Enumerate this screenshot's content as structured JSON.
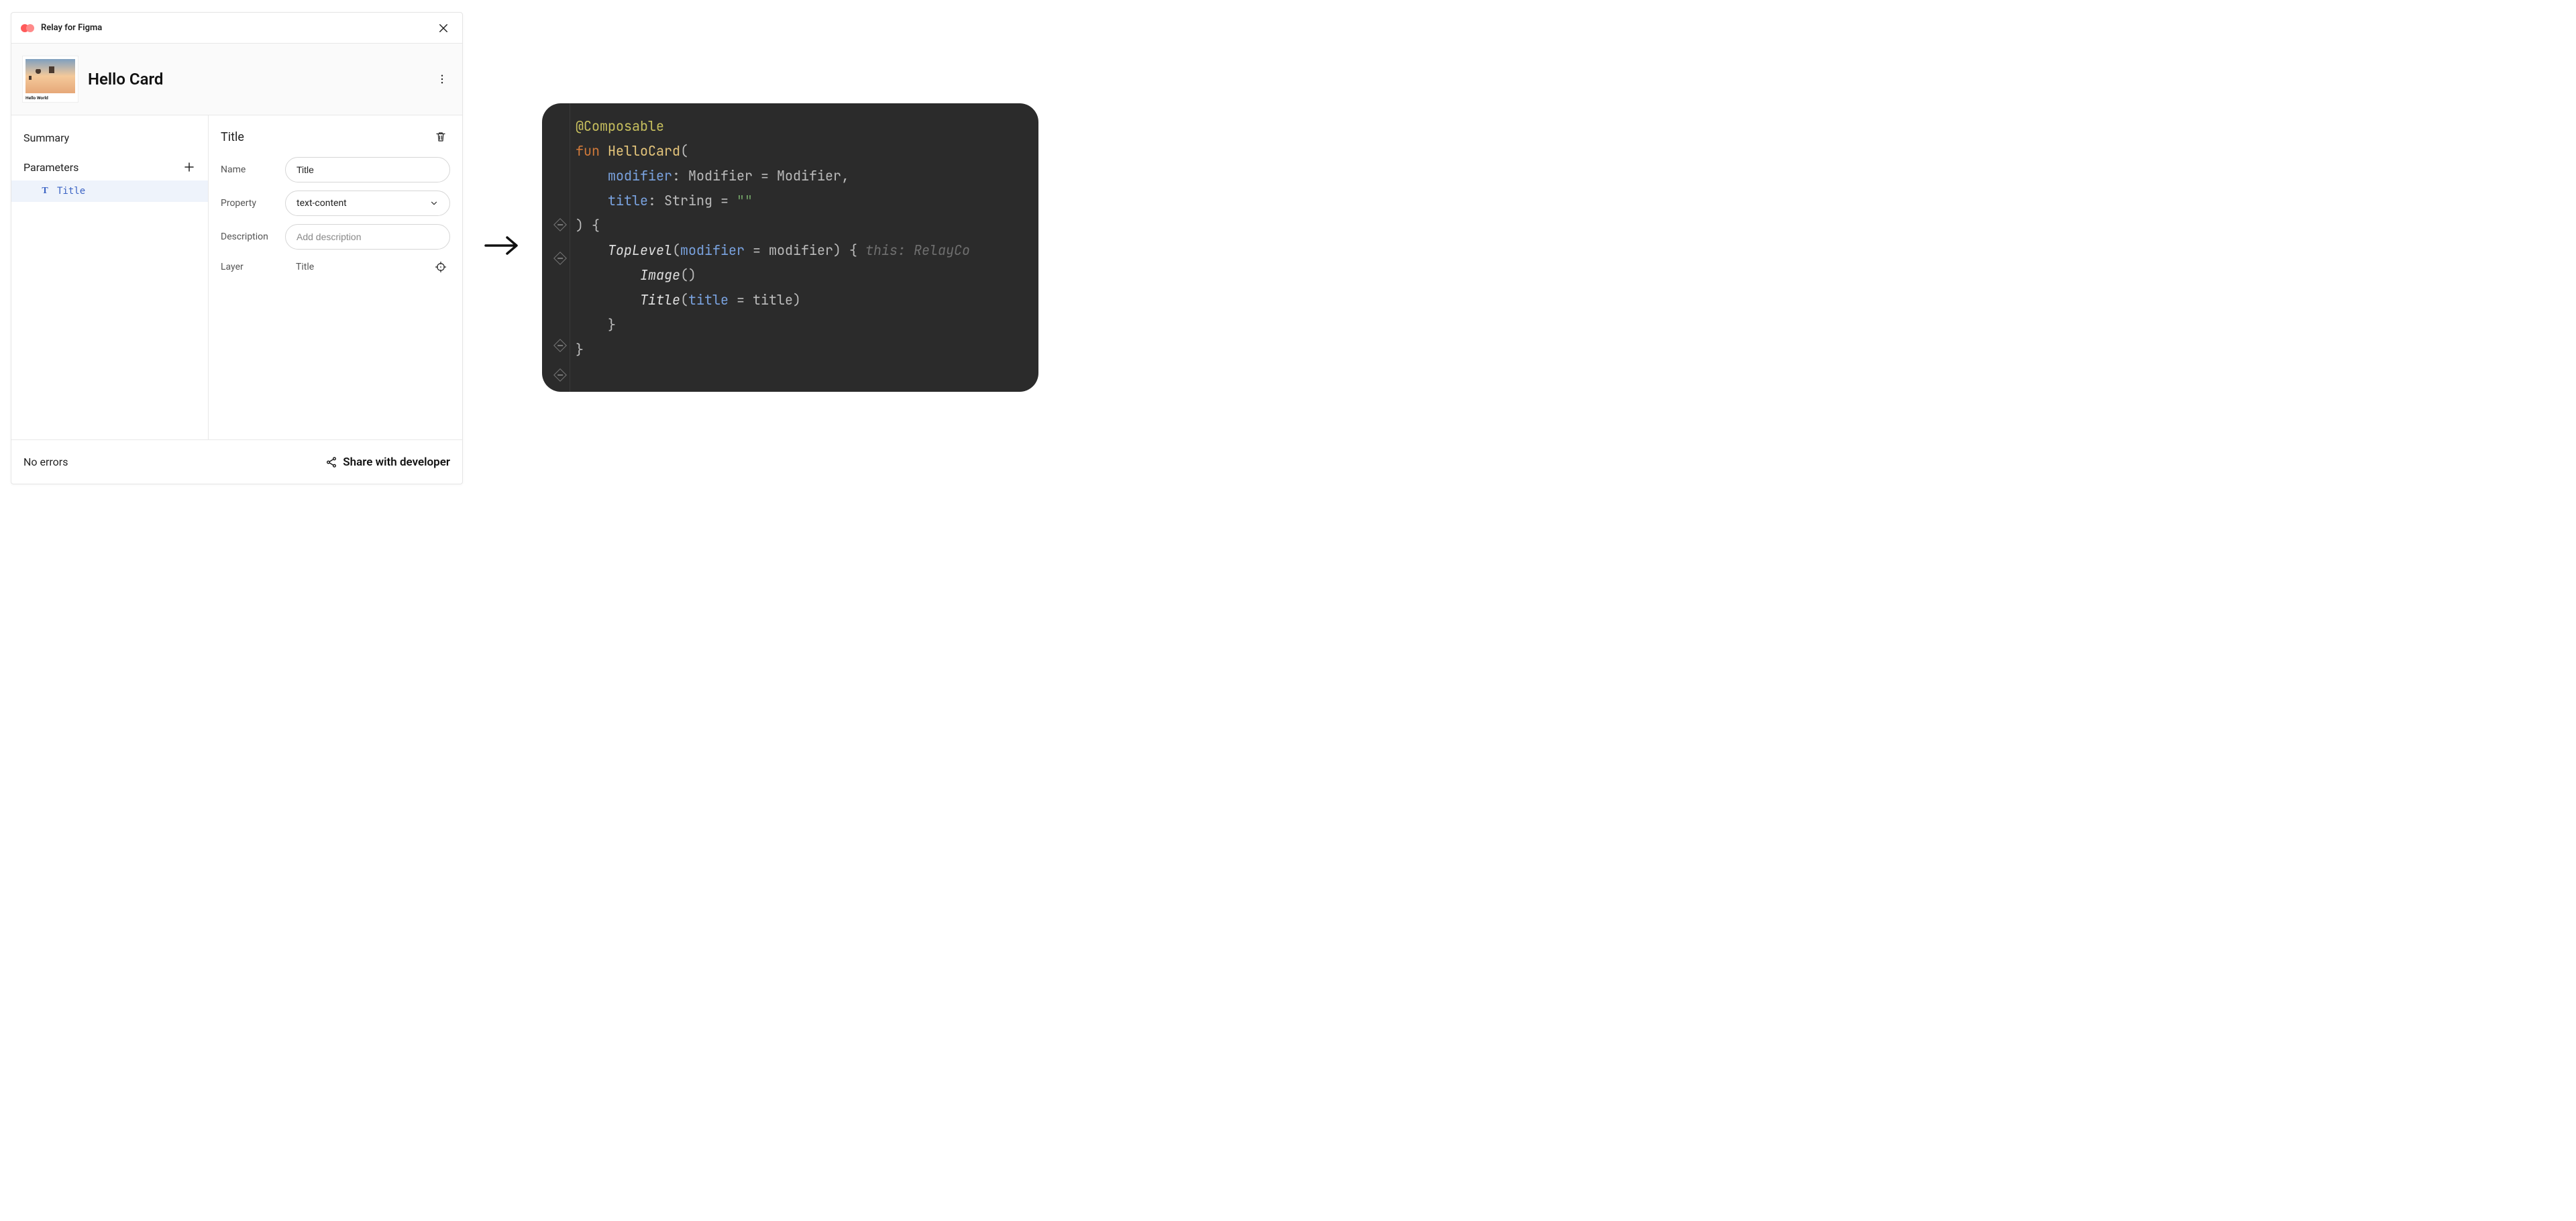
{
  "titlebar": {
    "title": "Relay for Figma"
  },
  "header": {
    "card_title": "Hello Card",
    "thumb_caption": "Hello World"
  },
  "sidebar": {
    "summary_label": "Summary",
    "parameters_label": "Parameters",
    "param_items": [
      {
        "icon": "T",
        "label": "Title"
      }
    ]
  },
  "detail": {
    "title": "Title",
    "name_label": "Name",
    "name_value": "Title",
    "property_label": "Property",
    "property_value": "text-content",
    "description_label": "Description",
    "description_placeholder": "Add description",
    "layer_label": "Layer",
    "layer_value": "Title"
  },
  "footer": {
    "status": "No errors",
    "share_label": "Share with developer"
  },
  "code": {
    "annotation": "@Composable",
    "fun_kw": "fun",
    "fn_name": "HelloCard",
    "modifier_param": "modifier",
    "modifier_type": "Modifier",
    "modifier_default": "Modifier",
    "title_param": "title",
    "title_type": "String",
    "title_default": "\"\"",
    "toplevel_call": "TopLevel",
    "toplevel_arg_name": "modifier",
    "toplevel_arg_val": "modifier",
    "hint": "this: RelayCo",
    "image_call": "Image",
    "title_call": "Title",
    "title_arg_name": "title",
    "title_arg_val": "title"
  }
}
